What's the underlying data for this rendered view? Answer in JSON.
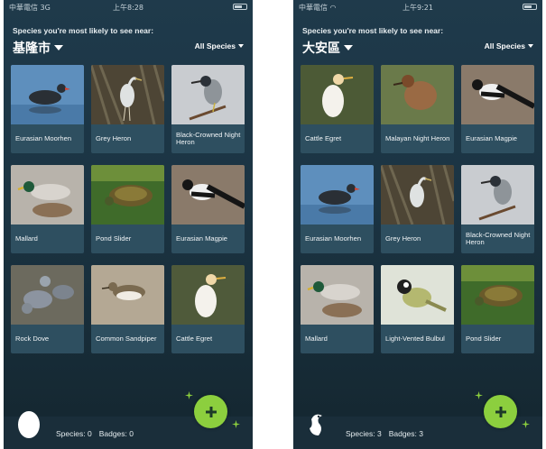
{
  "colors": {
    "accent": "#8ccf3e",
    "card": "#2e4f60",
    "background": "#1b3443"
  },
  "icons": {
    "add": "plus-icon",
    "species_left": "egg-icon",
    "species_right": "bird-icon"
  },
  "screens": [
    {
      "status": {
        "carrier": "中華電信  3G",
        "time": "上午8:28",
        "battery_label": ""
      },
      "header": {
        "subtitle": "Species you're most likely to see near:",
        "location": "基隆市",
        "filter": "All Species"
      },
      "cards": [
        {
          "name": "Eurasian Moorhen"
        },
        {
          "name": "Grey Heron"
        },
        {
          "name": "Black-Crowned Night Heron"
        },
        {
          "name": "Mallard"
        },
        {
          "name": "Pond Slider"
        },
        {
          "name": "Eurasian Magpie"
        },
        {
          "name": "Rock Dove"
        },
        {
          "name": "Common Sandpiper"
        },
        {
          "name": "Cattle Egret"
        }
      ],
      "footer": {
        "species": "Species: 0",
        "badges": "Badges: 0"
      }
    },
    {
      "status": {
        "carrier": "中華電信",
        "time": "上午9:21",
        "battery_label": ""
      },
      "header": {
        "subtitle": "Species you're most likely to see near:",
        "location": "大安區",
        "filter": "All Species"
      },
      "cards": [
        {
          "name": "Cattle Egret"
        },
        {
          "name": "Malayan Night Heron"
        },
        {
          "name": "Eurasian Magpie"
        },
        {
          "name": "Eurasian Moorhen"
        },
        {
          "name": "Grey Heron"
        },
        {
          "name": "Black-Crowned Night Heron"
        },
        {
          "name": "Mallard"
        },
        {
          "name": "Light-Vented Bulbul"
        },
        {
          "name": "Pond Slider"
        }
      ],
      "footer": {
        "species": "Species: 3",
        "badges": "Badges: 3"
      }
    }
  ]
}
